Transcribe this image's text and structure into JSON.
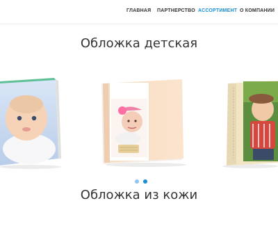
{
  "nav": {
    "items": [
      {
        "label": "ГЛАВНАЯ",
        "active": false
      },
      {
        "label": "ПАРТНЕРСТВО",
        "active": false
      },
      {
        "label": "АССОРТИМЕНТ",
        "active": true
      },
      {
        "label": "О КОМПАНИИ",
        "active": false
      }
    ]
  },
  "sections": {
    "kids_title": "Обложка детская",
    "leather_title": "Обложка из кожи"
  },
  "carousel": {
    "active_index": 1,
    "dot_count": 2,
    "colors": {
      "dot_active": "#1a8fd6",
      "dot_inactive": "#8fc6ea"
    }
  }
}
